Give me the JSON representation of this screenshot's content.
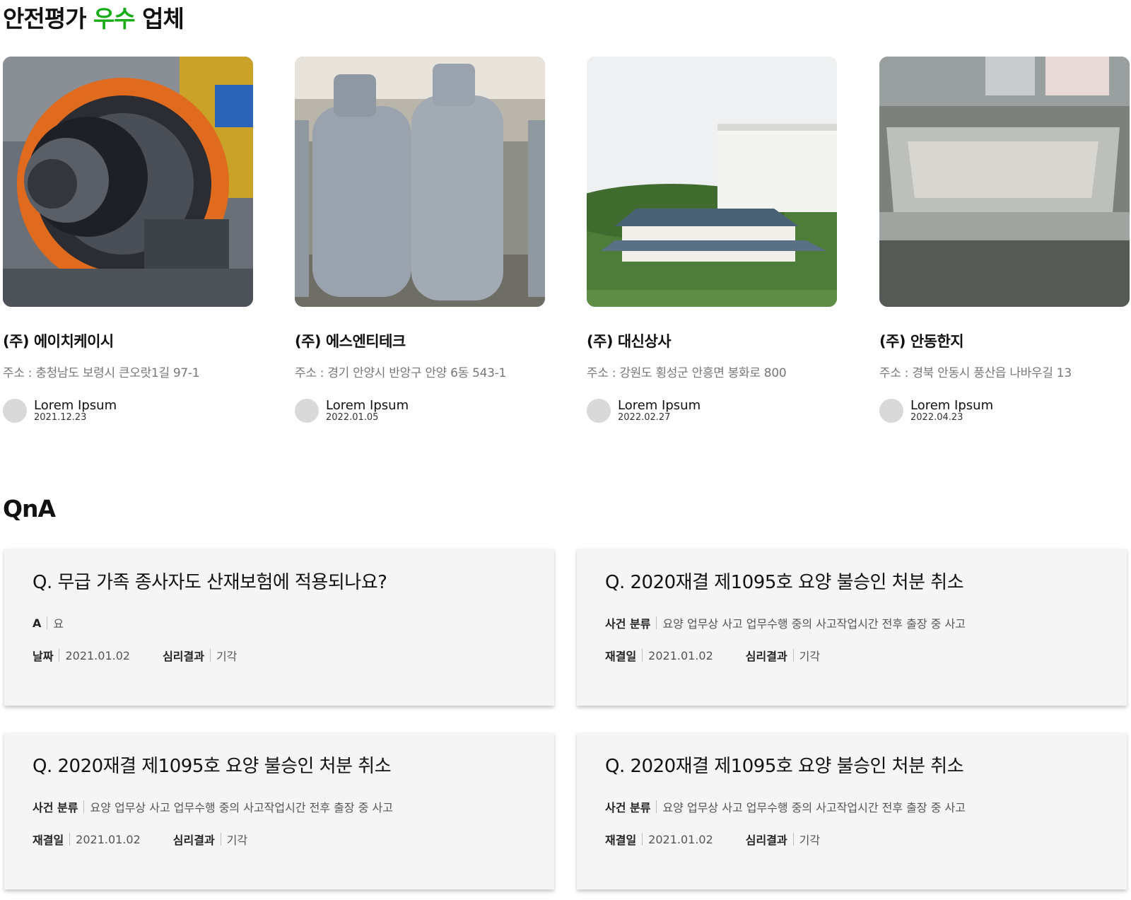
{
  "safety_section": {
    "title_prefix": "안전평가 ",
    "title_accent": "우수",
    "title_suffix": " 업체",
    "accent_color": "#1aad19",
    "companies": [
      {
        "name": "(주) 에이치케이시",
        "address": "주소 : 충청남도 보령시 큰오랏1길 97-1",
        "author": "Lorem Ipsum",
        "date": "2021.12.23",
        "image": "industrial-machine-photo"
      },
      {
        "name": "(주) 에스엔티테크",
        "address": "주소 : 경기 안양시 반앙구 안양 6동 543-1",
        "author": "Lorem Ipsum",
        "date": "2022.01.05",
        "image": "lpg-cylinders-photo"
      },
      {
        "name": "(주) 대신상사",
        "address": "주소 : 강원도 횡성군 안흥면 봉화로 800",
        "author": "Lorem Ipsum",
        "date": "2022.02.27",
        "image": "building-campus-photo"
      },
      {
        "name": "(주) 안동한지",
        "address": "주소 : 경북 안동시 풍산읍 나바우길 13",
        "author": "Lorem Ipsum",
        "date": "2022.04.23",
        "image": "steel-tank-photo"
      }
    ]
  },
  "qna_section": {
    "title": "QnA",
    "items": [
      {
        "question": "Q. 무급 가족 종사자도 산재보험에 적용되나요?",
        "row1_label": "A",
        "row1_value": "요",
        "row2_label1": "날짜",
        "row2_value1": "2021.01.02",
        "row2_label2": "심리결과",
        "row2_value2": "기각"
      },
      {
        "question": "Q. 2020재결 제1095호 요양 불승인 처분 취소",
        "row1_label": "사건 분류",
        "row1_value": "요양 업무상 사고 업무수행 중의 사고작업시간 전후 출장 중 사고",
        "row2_label1": "재결일",
        "row2_value1": "2021.01.02",
        "row2_label2": "심리결과",
        "row2_value2": "기각"
      },
      {
        "question": "Q. 2020재결 제1095호 요양 불승인 처분 취소",
        "row1_label": "사건 분류",
        "row1_value": "요양 업무상 사고 업무수행 중의 사고작업시간 전후 출장 중 사고",
        "row2_label1": "재결일",
        "row2_value1": "2021.01.02",
        "row2_label2": "심리결과",
        "row2_value2": "기각"
      },
      {
        "question": "Q. 2020재결 제1095호 요양 불승인 처분 취소",
        "row1_label": "사건 분류",
        "row1_value": "요양 업무상 사고 업무수행 중의 사고작업시간 전후 출장 중 사고",
        "row2_label1": "재결일",
        "row2_value1": "2021.01.02",
        "row2_label2": "심리결과",
        "row2_value2": "기각"
      }
    ]
  }
}
